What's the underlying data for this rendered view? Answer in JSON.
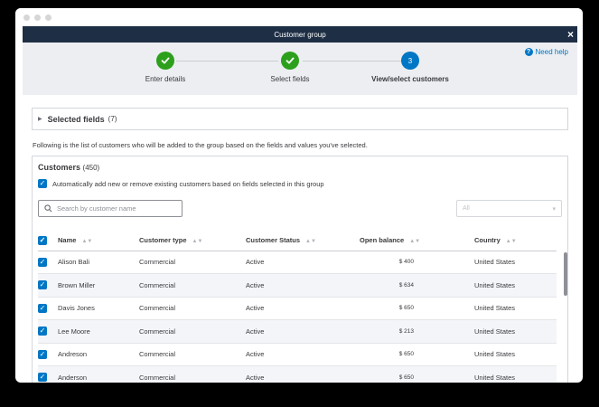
{
  "modal": {
    "title": "Customer group",
    "close": "×"
  },
  "help": {
    "label": "Need help",
    "icon": "question-icon"
  },
  "steps": [
    {
      "label": "Enter details",
      "status": "done",
      "icon": "checkmark-icon"
    },
    {
      "label": "Select fields",
      "status": "done",
      "icon": "checkmark-icon"
    },
    {
      "label": "View/select customers",
      "status": "current",
      "number": "3"
    }
  ],
  "selected_fields": {
    "title": "Selected fields",
    "count": "(7)"
  },
  "note": "Following is the list of customers who will be added to the group based on the fields and values you've selected.",
  "customers": {
    "title": "Customers",
    "count": "(450)",
    "auto_label": "Automatically add new or remove existing customers based on fields selected in this group",
    "search_placeholder": "Search by customer name",
    "filter_value": "All",
    "columns": [
      "Name",
      "Customer type",
      "Customer Status",
      "Open balance",
      "Country"
    ],
    "rows": [
      {
        "name": "Alison Bali",
        "type": "Commercial",
        "status": "Active",
        "balance": "$ 400",
        "country": "United States"
      },
      {
        "name": "Brown Miller",
        "type": "Commercial",
        "status": "Active",
        "balance": "$ 634",
        "country": "United States"
      },
      {
        "name": "Davis Jones",
        "type": "Commercial",
        "status": "Active",
        "balance": "$ 650",
        "country": "United States"
      },
      {
        "name": "Lee Moore",
        "type": "Commercial",
        "status": "Active",
        "balance": "$ 213",
        "country": "United States"
      },
      {
        "name": "Andreson",
        "type": "Commercial",
        "status": "Active",
        "balance": "$ 650",
        "country": "United States"
      },
      {
        "name": "Anderson",
        "type": "Commercial",
        "status": "Active",
        "balance": "$ 650",
        "country": "United States"
      }
    ]
  },
  "colors": {
    "primary": "#0077c5",
    "success": "#2ca01c",
    "titlebar": "#1e2f45"
  }
}
